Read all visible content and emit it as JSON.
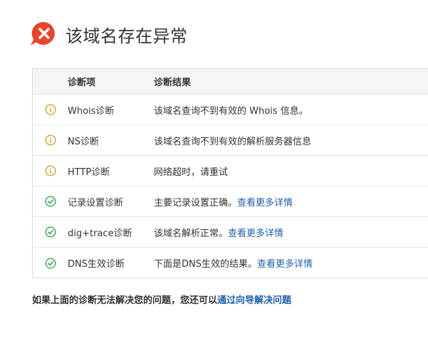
{
  "header": {
    "title": "该域名存在异常",
    "icon": "error-x-icon",
    "icon_color": "#e8452c"
  },
  "table": {
    "columns": [
      "诊断项",
      "诊断结果"
    ],
    "rows": [
      {
        "status": "warning",
        "icon": "info-circle-icon",
        "item": "Whois诊断",
        "result": "该域名查询不到有效的 Whois 信息。",
        "link": ""
      },
      {
        "status": "warning",
        "icon": "info-circle-icon",
        "item": "NS诊断",
        "result": "该域名查询不到有效的解析服务器信息",
        "link": ""
      },
      {
        "status": "warning",
        "icon": "info-circle-icon",
        "item": "HTTP诊断",
        "result": "网络超时，请重试",
        "link": ""
      },
      {
        "status": "ok",
        "icon": "check-circle-icon",
        "item": "记录设置诊断",
        "result": "主要记录设置正确。",
        "link": "查看更多详情"
      },
      {
        "status": "ok",
        "icon": "check-circle-icon",
        "item": "dig+trace诊断",
        "result": "该域名解析正常。",
        "link": "查看更多详情"
      },
      {
        "status": "ok",
        "icon": "check-circle-icon",
        "item": "DNS生效诊断",
        "result": "下面是DNS生效的结果。",
        "link": "查看更多详情"
      }
    ]
  },
  "footer": {
    "text": "如果上面的诊断无法解决您的问题，您还可以",
    "link": "通过向导解决问题"
  },
  "colors": {
    "warning": "#d89a2b",
    "ok": "#3aa64a",
    "link": "#1e5fa8"
  }
}
